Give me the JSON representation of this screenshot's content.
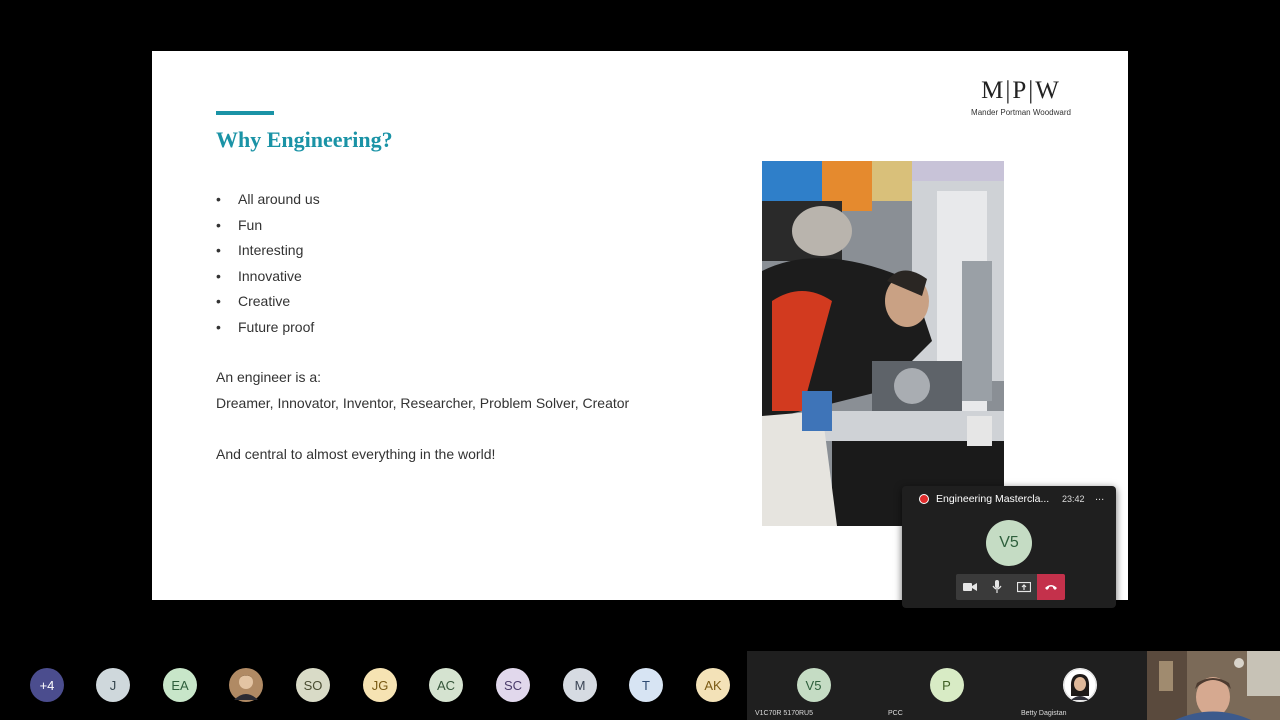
{
  "slide": {
    "title": "Why Engineering?",
    "logo": {
      "mark": "M|P|W",
      "subtitle": "Mander Portman Woodward"
    },
    "bullets": [
      "All around us",
      "Fun",
      "Interesting",
      "Innovative",
      "Creative",
      "Future proof"
    ],
    "engineer_intro": "An engineer is a:",
    "engineer_roles": "Dreamer, Innovator, Inventor, Researcher, Problem Solver, Creator",
    "closing": "And central to almost everything in the world!",
    "accent_color": "#1a93a6"
  },
  "mini_window": {
    "title": "Engineering Mastercla...",
    "time": "23:42",
    "more": "...",
    "avatar_initials": "V5",
    "controls": [
      "camera-icon",
      "microphone-icon",
      "share-screen-icon",
      "hang-up-icon"
    ]
  },
  "participants": [
    {
      "initials": "+4",
      "bg": "#4b4d8e",
      "fg": "#ffffff"
    },
    {
      "initials": "J",
      "bg": "#cfd8dc",
      "fg": "#37474f"
    },
    {
      "initials": "EA",
      "bg": "#c8e6c9",
      "fg": "#2e5f3c"
    },
    {
      "initials": "",
      "bg": "#b08a64",
      "fg": "#ffffff"
    },
    {
      "initials": "SO",
      "bg": "#d9dbc7",
      "fg": "#4a4d32"
    },
    {
      "initials": "JG",
      "bg": "#f6e3b3",
      "fg": "#7a5a14"
    },
    {
      "initials": "AC",
      "bg": "#d5e3d0",
      "fg": "#35553a"
    },
    {
      "initials": "SC",
      "bg": "#e1d8ec",
      "fg": "#4b3c6b"
    },
    {
      "initials": "M",
      "bg": "#d6dbe2",
      "fg": "#3a4454"
    },
    {
      "initials": "T",
      "bg": "#d7e4f3",
      "fg": "#2f4b72"
    },
    {
      "initials": "AK",
      "bg": "#f3e2b8",
      "fg": "#7a5a14"
    }
  ],
  "tiles": [
    {
      "initials": "V5",
      "label": "V1C70R 5170RU5",
      "bg": "#c5dcc4",
      "fg": "#2e5f3c"
    },
    {
      "initials": "P",
      "label": "PCC",
      "bg": "#d8ebc5",
      "fg": "#3f5e24"
    },
    {
      "initials": "",
      "label": "Betty Dagistan",
      "bg": "#ffffff",
      "fg": "#333333"
    }
  ]
}
